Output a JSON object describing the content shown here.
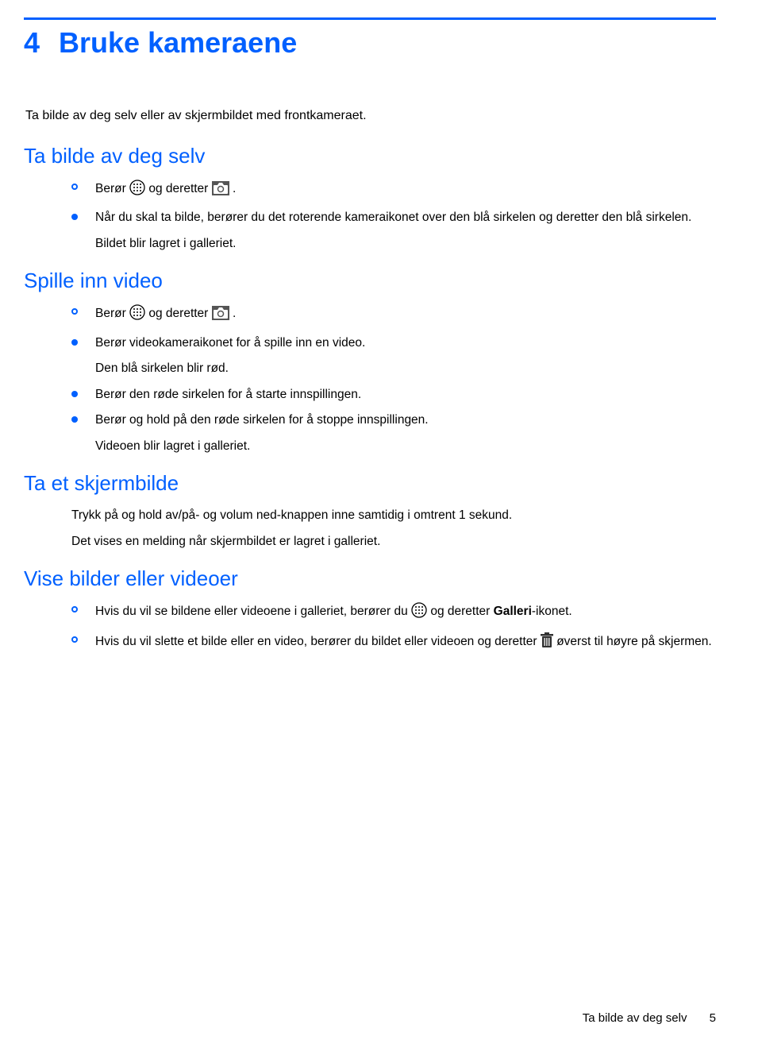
{
  "chapter": {
    "number": "4",
    "title": "Bruke kameraene"
  },
  "intro": "Ta bilde av deg selv eller av skjermbildet med frontkameraet.",
  "s1": {
    "heading": "Ta bilde av deg selv",
    "r1a": "Berør ",
    "r1b": " og deretter ",
    "r1c": ".",
    "r2": "Når du skal ta bilde, berører du det roterende kameraikonet over den blå sirkelen og deretter den blå sirkelen.",
    "r3": "Bildet blir lagret i galleriet."
  },
  "s2": {
    "heading": "Spille inn video",
    "r1a": "Berør ",
    "r1b": " og deretter ",
    "r1c": ".",
    "r2": "Berør videokameraikonet for å spille inn en video.",
    "r3": "Den blå sirkelen blir rød.",
    "r4": "Berør den røde sirkelen for å starte innspillingen.",
    "r5": "Berør og hold på den røde sirkelen for å stoppe innspillingen.",
    "r6": "Videoen blir lagret i galleriet."
  },
  "s3": {
    "heading": "Ta et skjermbilde",
    "r1": "Trykk på og hold av/på- og volum ned-knappen inne samtidig i omtrent 1 sekund.",
    "r2": "Det vises en melding når skjermbildet er lagret i galleriet."
  },
  "s4": {
    "heading": "Vise bilder eller videoer",
    "r1a": "Hvis du vil se bildene eller videoene i galleriet, berører du ",
    "r1b": " og deretter ",
    "r1c": "Galleri",
    "r1d": "-ikonet.",
    "r2a": "Hvis du vil slette et bilde eller en video, berører du bildet eller videoen og deretter ",
    "r2b": " øverst til høyre på skjermen."
  },
  "footer": {
    "text": "Ta bilde av deg selv",
    "page": "5"
  }
}
